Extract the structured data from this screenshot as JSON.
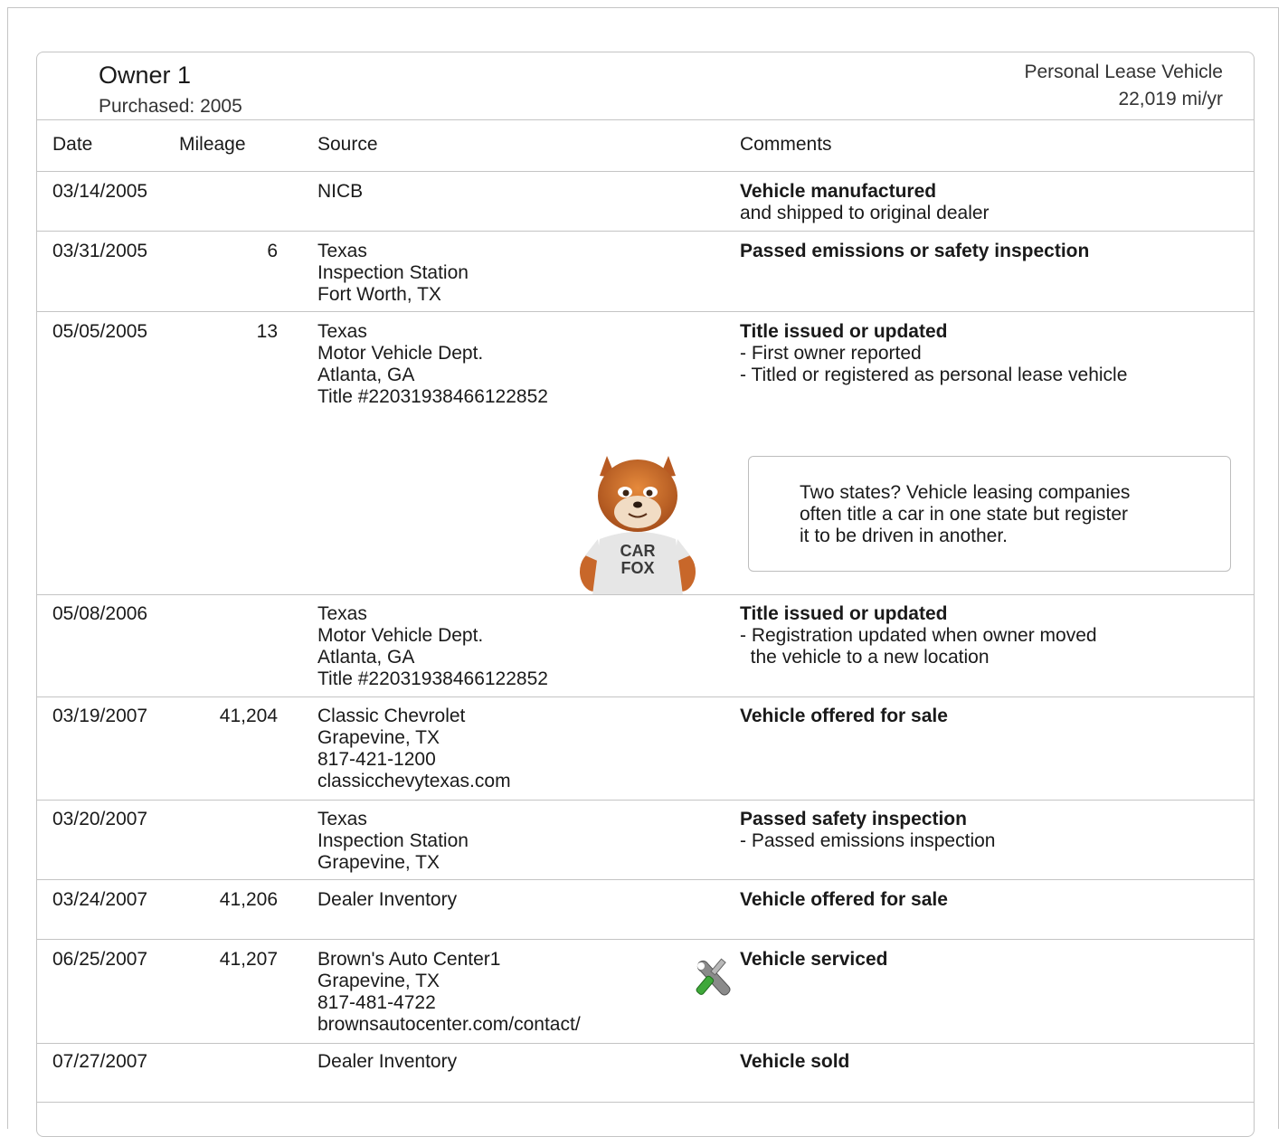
{
  "owner": {
    "title": "Owner 1",
    "purchased": "Purchased: 2005",
    "type": "Personal Lease Vehicle",
    "miles_per_year": "22,019 mi/yr"
  },
  "headers": {
    "date": "Date",
    "mileage": "Mileage",
    "source": "Source",
    "comments": "Comments"
  },
  "rows": [
    {
      "date": "03/14/2005",
      "mileage": "",
      "source": [
        "NICB"
      ],
      "comment_title": "Vehicle manufactured",
      "comment_lines": [
        "and shipped to original dealer"
      ]
    },
    {
      "date": "03/31/2005",
      "mileage": "6",
      "source": [
        "Texas",
        "Inspection Station",
        "Fort Worth, TX"
      ],
      "comment_title": "Passed emissions or safety inspection",
      "comment_lines": []
    },
    {
      "date": "05/05/2005",
      "mileage": "13",
      "source": [
        "Texas",
        "Motor Vehicle Dept.",
        "Atlanta, GA",
        "Title #22031938466122852"
      ],
      "comment_title": "Title issued or updated",
      "comment_lines": [
        "- First owner reported",
        "- Titled or registered as personal lease vehicle"
      ]
    },
    {
      "date": "05/08/2006",
      "mileage": "",
      "source": [
        "Texas",
        "Motor Vehicle Dept.",
        "Atlanta, GA",
        "Title #22031938466122852"
      ],
      "comment_title": "Title issued or updated",
      "comment_lines": [
        "- Registration updated when owner moved",
        "  the vehicle to a new location"
      ]
    },
    {
      "date": "03/19/2007",
      "mileage": "41,204",
      "source": [
        "Classic Chevrolet",
        "Grapevine, TX",
        "817-421-1200",
        "classicchevytexas.com"
      ],
      "comment_title": "Vehicle offered for sale",
      "comment_lines": []
    },
    {
      "date": "03/20/2007",
      "mileage": "",
      "source": [
        "Texas",
        "Inspection Station",
        "Grapevine, TX"
      ],
      "comment_title": "Passed safety inspection",
      "comment_lines": [
        "- Passed emissions inspection"
      ]
    },
    {
      "date": "03/24/2007",
      "mileage": "41,206",
      "source": [
        "Dealer Inventory"
      ],
      "comment_title": "Vehicle offered for sale",
      "comment_lines": []
    },
    {
      "date": "06/25/2007",
      "mileage": "41,207",
      "source": [
        "Brown's Auto Center1",
        "Grapevine, TX",
        "817-481-4722",
        "brownsautocenter.com/contact/"
      ],
      "comment_title": "Vehicle serviced",
      "comment_lines": []
    },
    {
      "date": "07/27/2007",
      "mileage": "",
      "source": [
        "Dealer Inventory"
      ],
      "comment_title": "Vehicle sold",
      "comment_lines": []
    }
  ],
  "tip": {
    "lines": [
      "Two states? Vehicle leasing companies",
      "often title a car in one state but register",
      "it to be driven in another."
    ]
  },
  "mascot": {
    "shirt_line1": "CAR",
    "shirt_line2": "FOX"
  },
  "icons": {
    "service": "wrench-screwdriver-icon",
    "mascot": "carfox-mascot"
  }
}
